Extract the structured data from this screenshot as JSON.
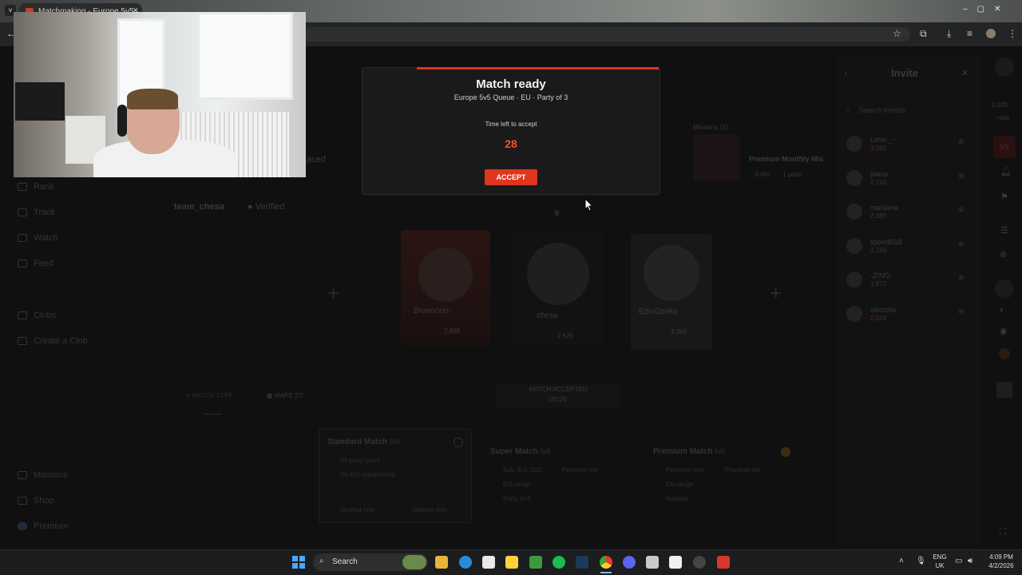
{
  "browser": {
    "tab_title": "Matchmaking - Europe 5v5",
    "nav_back": "←",
    "tab_close": "✕",
    "star": "☆",
    "menu": "⋮"
  },
  "sidebar": {
    "items": [
      {
        "label": "Rank"
      },
      {
        "label": "Track"
      },
      {
        "label": "Watch"
      },
      {
        "label": "Feed"
      },
      {
        "label": "Clubs"
      },
      {
        "label": "Create a Club"
      },
      {
        "label": "Missions"
      },
      {
        "label": "Shop"
      },
      {
        "label": "Premium"
      }
    ]
  },
  "party": {
    "team_name": "team_chesa",
    "verified": "Verified",
    "placed": "aced",
    "missions_label": "Missions (1)",
    "mission_title": "Premium Monthly Mis",
    "mission_meta": "0.0%",
    "mission_reward": "1 prize",
    "players": [
      {
        "name": "Brunoooo-",
        "elo": "2,888"
      },
      {
        "name": "chesa",
        "elo": "2,625"
      },
      {
        "name": "EdinDzeko",
        "elo": "3,388"
      }
    ],
    "match_accepted": "MATCH ACCEPTED",
    "match_accepted_timer": "00:26",
    "match_type_tab": "MATCH TYPE",
    "maps_tab": "MAPS 7/7"
  },
  "match_types": [
    {
      "title": "Standard Match",
      "tag": "5v5",
      "lines": [
        "All party sizes",
        "No Elo requirement"
      ],
      "footer": [
        "Verified only",
        "Veteran only"
      ]
    },
    {
      "title": "Super Match",
      "tag": "5v5",
      "lines": [
        "5v5, 3v3, 2v2",
        "Elo range",
        "Party 4+5"
      ],
      "footer": [
        "Premium tier"
      ]
    },
    {
      "title": "Premium Match",
      "tag": "5v5",
      "lines": [
        "Premium only",
        "Elo range",
        "Ranked"
      ],
      "footer": [
        "Premium tier"
      ]
    }
  ],
  "invite": {
    "title": "Invite",
    "search_placeholder": "Search friends",
    "friends": [
      {
        "name": "Lima-_-",
        "elo": "3,061"
      },
      {
        "name": "plana",
        "elo": "2,710"
      },
      {
        "name": "marijana",
        "elo": "2,380"
      },
      {
        "name": "speed018",
        "elo": "2,150"
      },
      {
        "name": "-ZING-",
        "elo": "1,977"
      },
      {
        "name": "slimzzla",
        "elo": "2,024"
      }
    ]
  },
  "right_rail": {
    "elo": "2,025",
    "elo_sub": "+800",
    "vs": "VS"
  },
  "modal": {
    "title": "Match ready",
    "subtitle": "Europe 5v5 Queue · EU · Party of 3",
    "time_label": "Time left to accept",
    "countdown": "28",
    "accept_label": "ACCEPT"
  },
  "taskbar": {
    "search_label": "Search",
    "lang_line1": "ENG",
    "lang_line2": "UK",
    "time": "4:09 PM",
    "date": "4/2/2026"
  },
  "colors": {
    "accent": "#e0351e",
    "countdown": "#ff4d2b"
  }
}
